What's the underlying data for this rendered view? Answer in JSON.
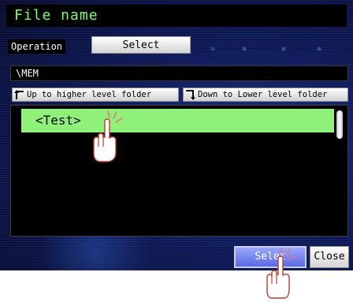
{
  "header": {
    "title": "File name"
  },
  "operation": {
    "label": "Operation",
    "selected_value": "Select"
  },
  "path": {
    "current": "\\MEM"
  },
  "navigation": {
    "up_label": "Up to higher level folder",
    "down_label": "Down to Lower level folder"
  },
  "file_list": {
    "items": [
      {
        "label": "<Test>",
        "selected": true
      }
    ]
  },
  "footer": {
    "select_label": "Selet",
    "close_label": "Close"
  },
  "colors": {
    "title_text": "#7cff6b",
    "selected_row": "#8ff07a",
    "select_button": "#6f7ef0",
    "background": "#0e1a5a"
  },
  "icons": {
    "up": "up-level-arrow-icon",
    "down": "down-level-arrow-icon",
    "pointer": "tap-hand-icon"
  }
}
